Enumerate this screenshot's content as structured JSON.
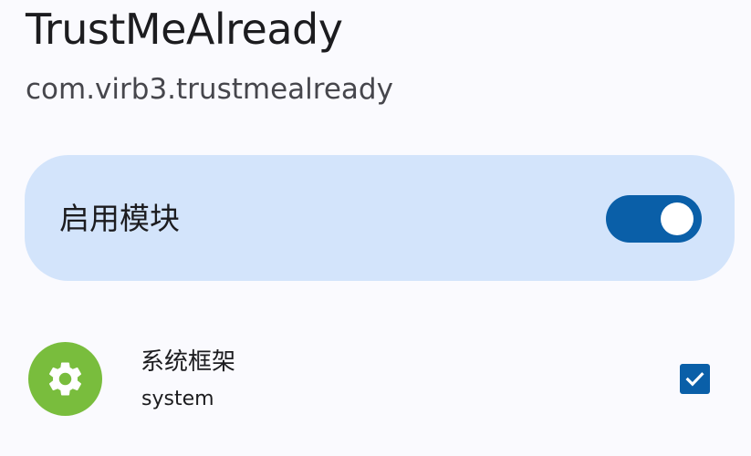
{
  "header": {
    "title": "TrustMeAlready",
    "package": "com.virb3.trustmealready"
  },
  "module_toggle": {
    "label": "启用模块",
    "enabled": true
  },
  "scope": {
    "items": [
      {
        "name": "系统框架",
        "package": "system",
        "icon": "gear-icon",
        "checked": true
      }
    ]
  },
  "colors": {
    "background": "#fafafe",
    "card": "#d3e4fb",
    "accent": "#0a5fa8",
    "icon_bg": "#79bd3d"
  }
}
